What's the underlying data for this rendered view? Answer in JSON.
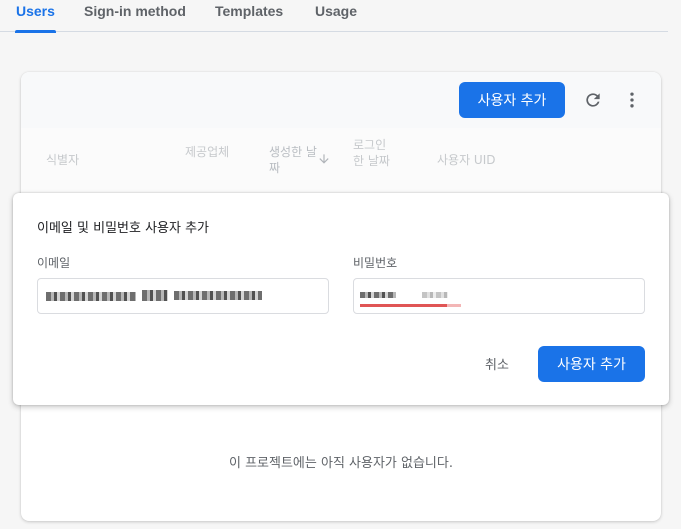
{
  "tabs": [
    {
      "label": "Users"
    },
    {
      "label": "Sign-in method"
    },
    {
      "label": "Templates"
    },
    {
      "label": "Usage"
    }
  ],
  "toolbar": {
    "add_user_label": "사용자 추가",
    "refresh_icon": "refresh-icon",
    "more_icon": "more-vert-icon"
  },
  "table": {
    "headers": [
      "식별자",
      "제공업체",
      "생성한 날짜",
      "로그인한 날짜",
      "사용자 UID"
    ],
    "empty_message": "이 프로젝트에는 아직 사용자가 없습니다."
  },
  "dialog": {
    "title": "이메일 및 비밀번호 사용자 추가",
    "email_label": "이메일",
    "email_value": "▮▮▮▮▮▮▮ ▮▮ ▮▮▮▮▮▮▮",
    "password_label": "비밀번호",
    "password_value": "▮▮▮▮ ▮▮▮",
    "cancel_label": "취소",
    "submit_label": "사용자 추가"
  },
  "colors": {
    "accent": "#1a73e8",
    "spellcheck": "#e05555"
  }
}
